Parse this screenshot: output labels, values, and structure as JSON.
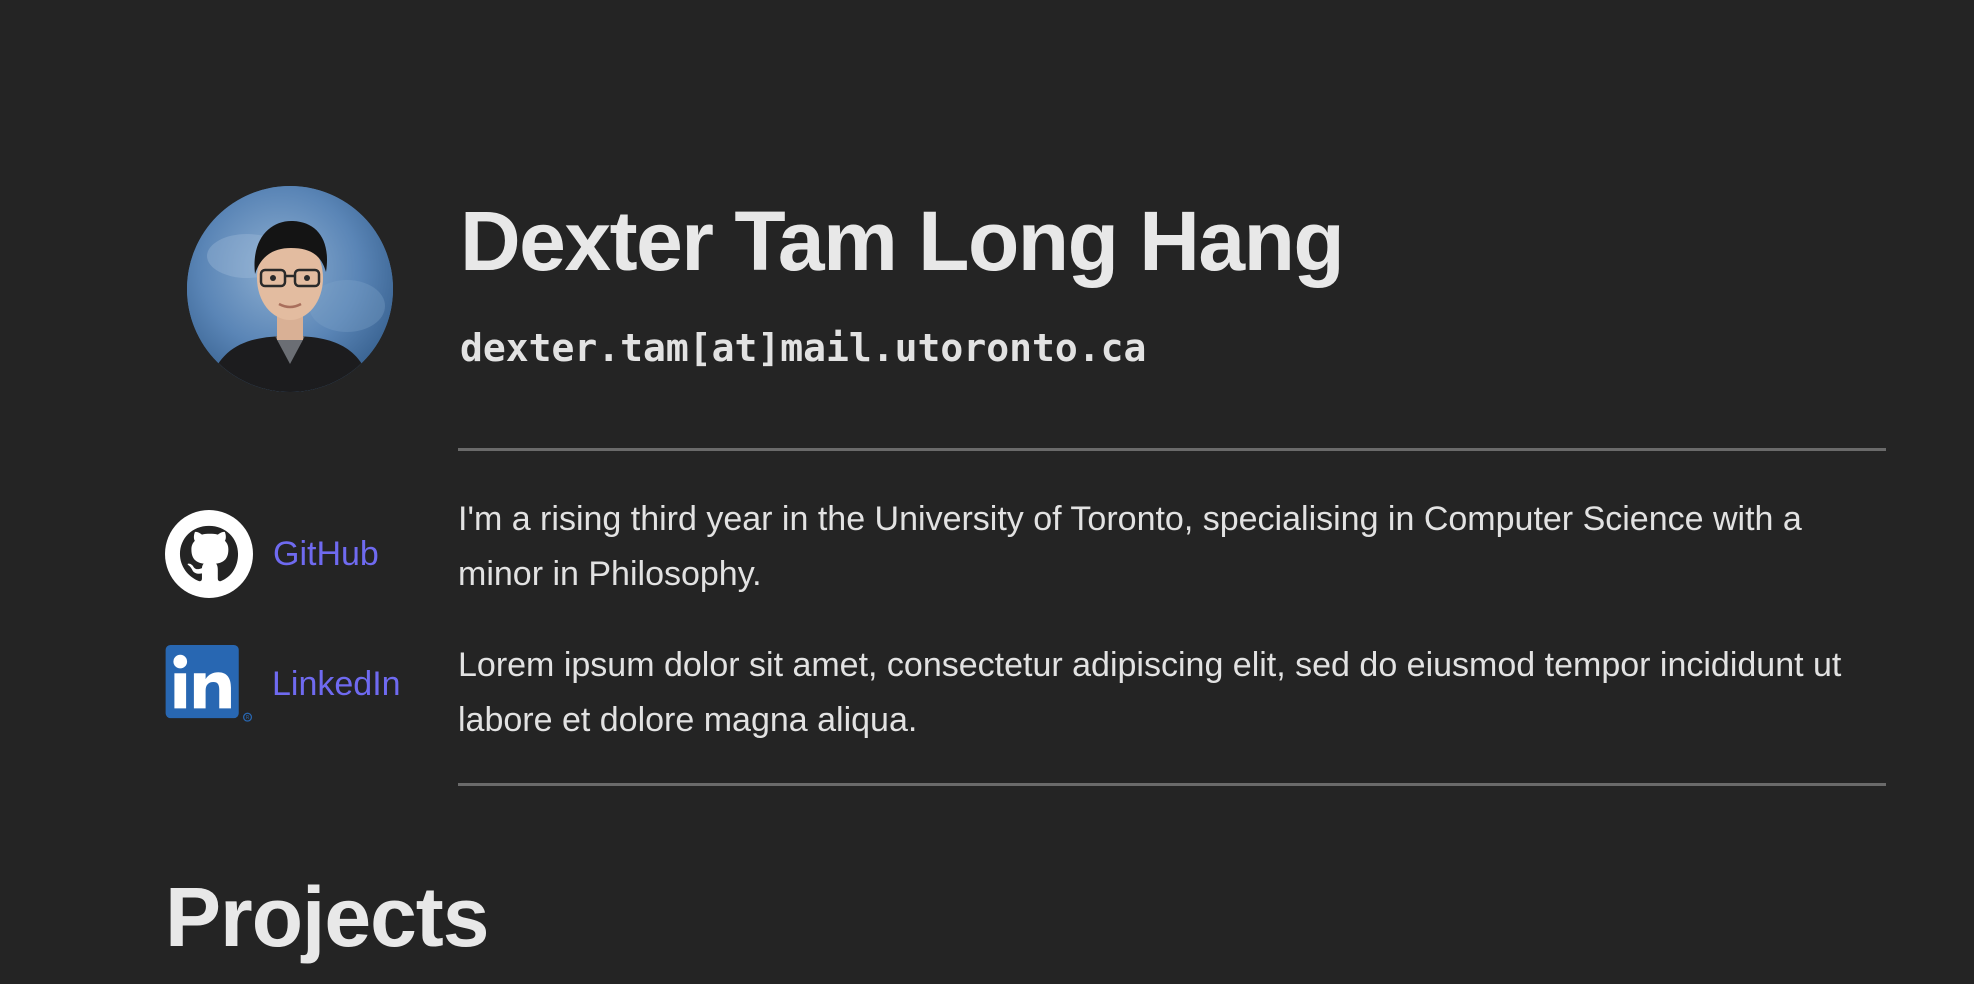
{
  "profile": {
    "name": "Dexter Tam Long Hang",
    "email": "dexter.tam[at]mail.utoronto.ca",
    "avatar_icon": "profile-photo"
  },
  "social": {
    "github": {
      "label": "GitHub",
      "icon": "github-icon"
    },
    "linkedin": {
      "label": "LinkedIn",
      "icon": "linkedin-icon"
    }
  },
  "bio": {
    "paragraph_1": "I'm a rising third year in the University of Toronto, specialising in Computer Science with a minor in Philosophy.",
    "paragraph_2": "Lorem ipsum dolor sit amet, consectetur adipiscing elit, sed do eiusmod tempor incididunt ut labore et dolore magna aliqua."
  },
  "sections": {
    "projects_title": "Projects"
  },
  "colors": {
    "background": "#242424",
    "text": "#e6e6e6",
    "link": "#6f6af0",
    "rule": "#6a6a6a",
    "linkedin_blue": "#2867b2"
  }
}
